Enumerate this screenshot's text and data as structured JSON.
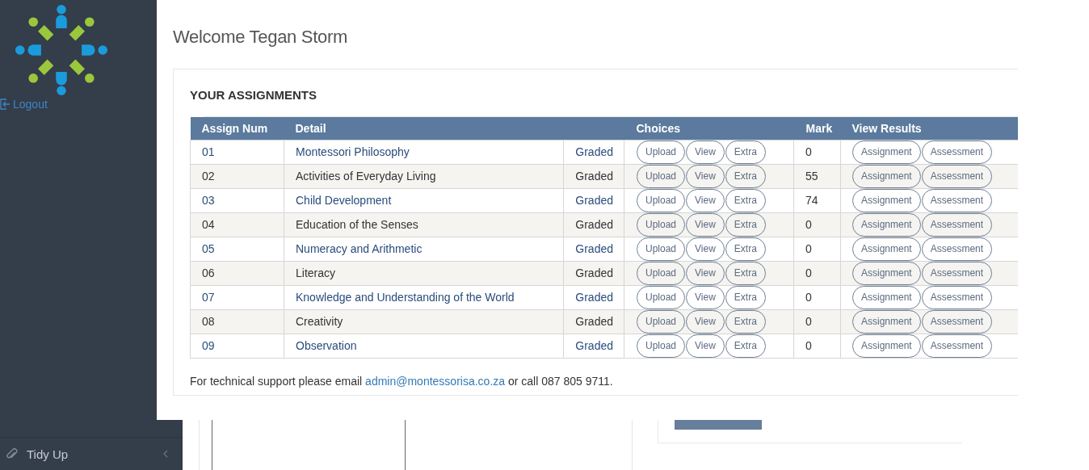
{
  "back_sidebar": {
    "items": [
      {
        "label": "Tidy Up"
      }
    ]
  },
  "sidebar": {
    "logout": "Logout"
  },
  "heading": "Welcome Tegan Storm",
  "panel": {
    "title": "YOUR ASSIGNMENTS",
    "table": {
      "columns": [
        "Assign Num",
        "Detail",
        "Choices",
        "Mark",
        "View Results"
      ],
      "rows": [
        {
          "num": "01",
          "detail": "Montessori Philosophy",
          "status": "Graded",
          "choices": [
            "Upload",
            "View",
            "Extra"
          ],
          "mark": "0",
          "results": [
            "Assignment",
            "Assessment"
          ],
          "shaded": false
        },
        {
          "num": "02",
          "detail": "Activities of Everyday Living",
          "status": "Graded",
          "choices": [
            "Upload",
            "View",
            "Extra"
          ],
          "mark": "55",
          "results": [
            "Assignment",
            "Assessment"
          ],
          "shaded": true
        },
        {
          "num": "03",
          "detail": "Child Development",
          "status": "Graded",
          "choices": [
            "Upload",
            "View",
            "Extra"
          ],
          "mark": "74",
          "results": [
            "Assignment",
            "Assessment"
          ],
          "shaded": false
        },
        {
          "num": "04",
          "detail": "Education of the Senses",
          "status": "Graded",
          "choices": [
            "Upload",
            "View",
            "Extra"
          ],
          "mark": "0",
          "results": [
            "Assignment",
            "Assessment"
          ],
          "shaded": true
        },
        {
          "num": "05",
          "detail": "Numeracy and Arithmetic",
          "status": "Graded",
          "choices": [
            "Upload",
            "View",
            "Extra"
          ],
          "mark": "0",
          "results": [
            "Assignment",
            "Assessment"
          ],
          "shaded": false
        },
        {
          "num": "06",
          "detail": "Literacy",
          "status": "Graded",
          "choices": [
            "Upload",
            "View",
            "Extra"
          ],
          "mark": "0",
          "results": [
            "Assignment",
            "Assessment"
          ],
          "shaded": true
        },
        {
          "num": "07",
          "detail": "Knowledge and Understanding of the World",
          "status": "Graded",
          "choices": [
            "Upload",
            "View",
            "Extra"
          ],
          "mark": "0",
          "results": [
            "Assignment",
            "Assessment"
          ],
          "shaded": false
        },
        {
          "num": "08",
          "detail": "Creativity",
          "status": "Graded",
          "choices": [
            "Upload",
            "View",
            "Extra"
          ],
          "mark": "0",
          "results": [
            "Assignment",
            "Assessment"
          ],
          "shaded": true
        },
        {
          "num": "09",
          "detail": "Observation",
          "status": "Graded",
          "choices": [
            "Upload",
            "View",
            "Extra"
          ],
          "mark": "0",
          "results": [
            "Assignment",
            "Assessment"
          ],
          "shaded": false
        }
      ]
    }
  },
  "support": {
    "before": "For technical support please email ",
    "email": "admin@montessorisa.co.za",
    "after": " or call 087 805 9711."
  }
}
